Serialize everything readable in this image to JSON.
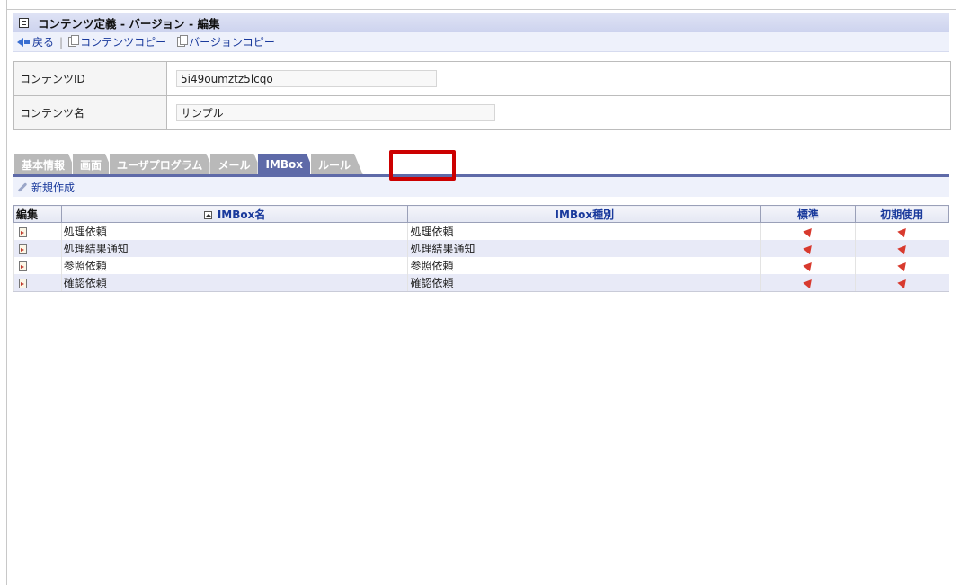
{
  "header": {
    "title": "コンテンツ定義 - バージョン - 編集"
  },
  "toolbar": {
    "back_label": "戻る",
    "content_copy_label": "コンテンツコピー",
    "version_copy_label": "バージョンコピー"
  },
  "info": {
    "content_id_label": "コンテンツID",
    "content_id_value": "5i49oumztz5lcqo",
    "content_name_label": "コンテンツ名",
    "content_name_value": "サンプル"
  },
  "tabs": [
    {
      "label": "基本情報"
    },
    {
      "label": "画面"
    },
    {
      "label": "ユーザプログラム"
    },
    {
      "label": "メール"
    },
    {
      "label": "IMBox"
    },
    {
      "label": "ルール"
    }
  ],
  "active_tab": "IMBox",
  "highlighted_tab": "ルール",
  "new_bar": {
    "new_label": "新規作成"
  },
  "grid": {
    "headers": {
      "edit": "編集",
      "name": "IMBox名",
      "type": "IMBox種別",
      "standard": "標準",
      "initial_use": "初期使用"
    },
    "rows": [
      {
        "name": "処理依頼",
        "type": "処理依頼"
      },
      {
        "name": "処理結果通知",
        "type": "処理結果通知"
      },
      {
        "name": "参照依頼",
        "type": "参照依頼"
      },
      {
        "name": "確認依頼",
        "type": "確認依頼"
      }
    ]
  },
  "colors": {
    "accent": "#5e6aa8",
    "highlight": "#cc0000",
    "pin": "#d83a2e"
  }
}
